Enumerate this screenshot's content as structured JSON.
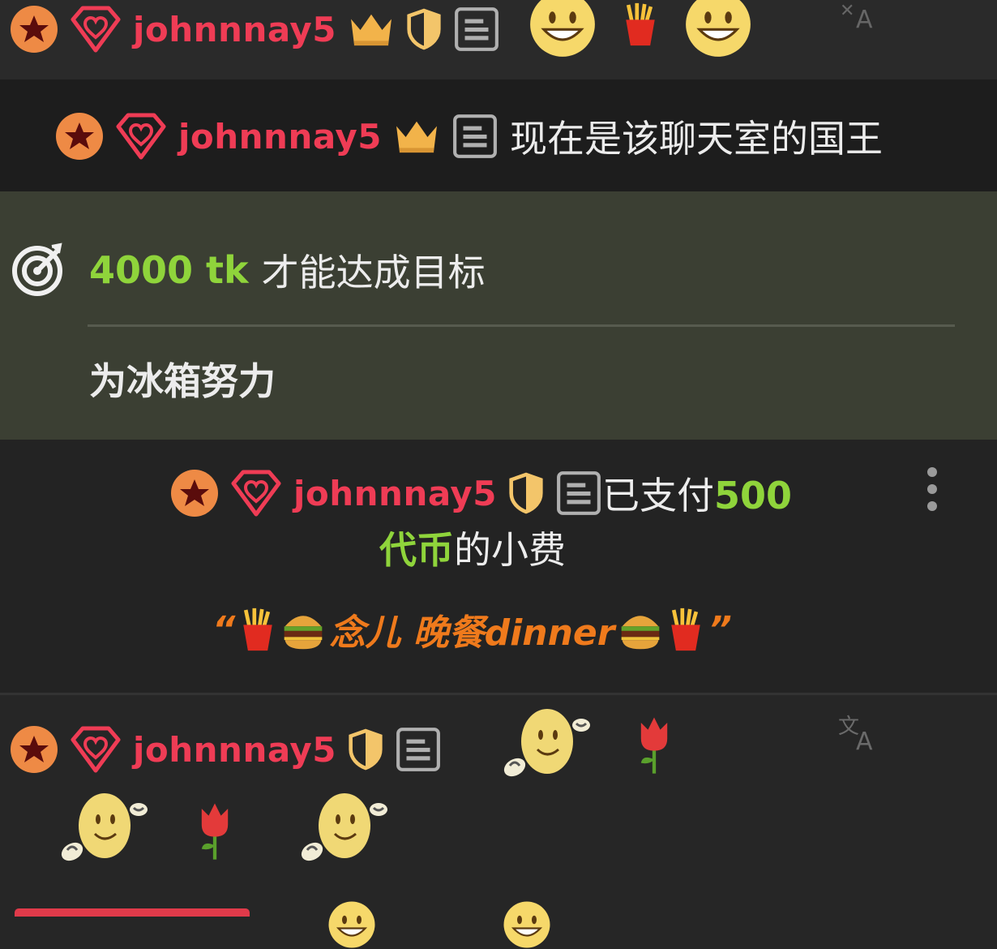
{
  "messages": [
    {
      "username": "johnnnay5"
    },
    {
      "username": "johnnnay5",
      "text": "现在是该聊天室的国王"
    },
    {
      "username": "johnnnay5",
      "text_before": "已支付",
      "amount": "500",
      "amount_unit": "代币",
      "text_after": "的小费",
      "quote_open": "“",
      "note": "念儿 晚餐dinner",
      "quote_close": "”"
    },
    {
      "username": "johnnnay5"
    }
  ],
  "goal": {
    "amount": "4000 tk",
    "suffix": "才能达成目标",
    "description": "为冰箱努力"
  },
  "icons": {
    "star": "star-badge-icon",
    "heart": "diamond-heart-icon",
    "crown": "crown-icon",
    "shield": "shield-icon",
    "notes": "notes-icon",
    "translate": "translate-icon",
    "target": "target-icon",
    "more": "more-vertical-icon"
  },
  "colors": {
    "username": "#ef3c55",
    "highlight_green": "#8fd43b",
    "tip_note": "#ef7a1c",
    "goal_bg": "#3b3f33"
  }
}
